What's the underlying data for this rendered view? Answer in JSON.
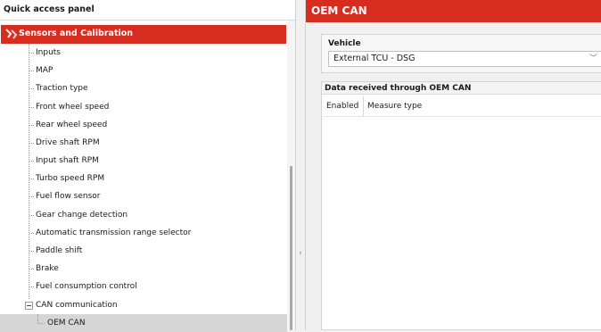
{
  "quick_access": {
    "title": "Quick access panel",
    "section": "Sensors and Calibration",
    "items": [
      {
        "label": "Inputs"
      },
      {
        "label": "MAP"
      },
      {
        "label": "Traction type"
      },
      {
        "label": "Front wheel speed"
      },
      {
        "label": "Rear wheel speed"
      },
      {
        "label": "Drive shaft RPM"
      },
      {
        "label": "Input shaft RPM"
      },
      {
        "label": "Turbo speed RPM"
      },
      {
        "label": "Fuel flow sensor"
      },
      {
        "label": "Gear change detection"
      },
      {
        "label": "Automatic transmission range selector"
      },
      {
        "label": "Paddle shift"
      },
      {
        "label": "Brake"
      },
      {
        "label": "Fuel consumption control"
      }
    ],
    "can_group": {
      "label": "CAN communication",
      "expanded": true
    },
    "selected_child": {
      "label": "OEM CAN"
    }
  },
  "oem_can": {
    "title": "OEM CAN",
    "vehicle_label": "Vehicle",
    "vehicle_value": "External TCU - DSG",
    "data_title": "Data received through OEM CAN",
    "columns": [
      "Enabled",
      "Measure type"
    ]
  },
  "colors": {
    "accent": "#d62d20",
    "selected_row": "#d6d6d6"
  }
}
